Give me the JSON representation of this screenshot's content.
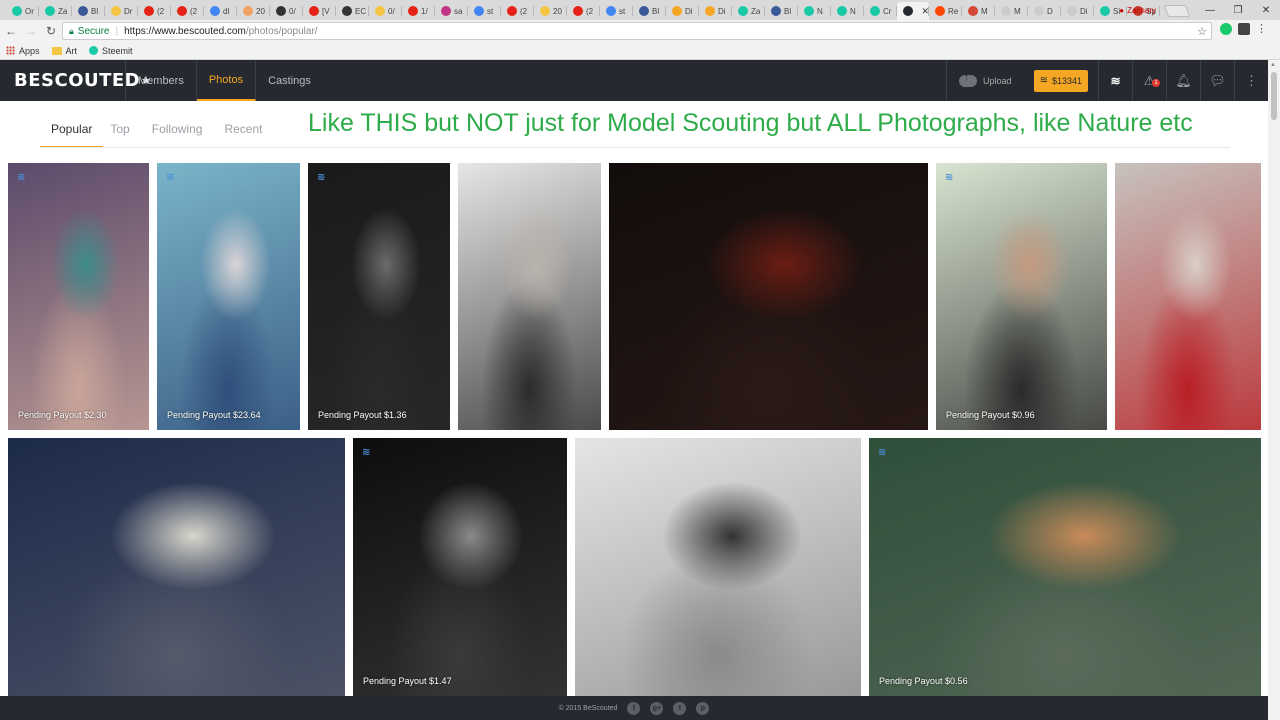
{
  "browser": {
    "tabs": [
      {
        "label": "Or",
        "color": "#1ac9a6"
      },
      {
        "label": "Za",
        "color": "#1ac9a6"
      },
      {
        "label": "Bl",
        "color": "#3b5998"
      },
      {
        "label": "Dr",
        "color": "#f4c542"
      },
      {
        "label": "(2",
        "color": "#e62117"
      },
      {
        "label": "(2",
        "color": "#e62117"
      },
      {
        "label": "dl",
        "color": "#4285f4"
      },
      {
        "label": "20",
        "color": "#f4a261"
      },
      {
        "label": "0/",
        "color": "#333333"
      },
      {
        "label": "[V",
        "color": "#e62117"
      },
      {
        "label": "EC",
        "color": "#333333"
      },
      {
        "label": "0/",
        "color": "#f4c542"
      },
      {
        "label": "1/",
        "color": "#e62117"
      },
      {
        "label": "sa",
        "color": "#c13584"
      },
      {
        "label": "st",
        "color": "#4285f4"
      },
      {
        "label": "(2",
        "color": "#e62117"
      },
      {
        "label": "20",
        "color": "#f4c542"
      },
      {
        "label": "(2",
        "color": "#e62117"
      },
      {
        "label": "st",
        "color": "#4285f4"
      },
      {
        "label": "Bl",
        "color": "#3b5998"
      },
      {
        "label": "Di",
        "color": "#f5a623"
      },
      {
        "label": "Di",
        "color": "#f5a623"
      },
      {
        "label": "Za",
        "color": "#1ac9a6"
      },
      {
        "label": "Bl",
        "color": "#3b5998"
      },
      {
        "label": "N",
        "color": "#1ac9a6"
      },
      {
        "label": "N",
        "color": "#1ac9a6"
      },
      {
        "label": "Cr",
        "color": "#1ac9a6"
      },
      {
        "label": "",
        "color": "#262a30",
        "active": true
      },
      {
        "label": "Re",
        "color": "#ff4500"
      },
      {
        "label": "M",
        "color": "#d44638"
      },
      {
        "label": "M",
        "color": "#cccccc"
      },
      {
        "label": "D",
        "color": "#cccccc"
      },
      {
        "label": "Di",
        "color": "#cccccc"
      },
      {
        "label": "Si",
        "color": "#1ac9a6"
      },
      {
        "label": "Sp",
        "color": "#c0392b"
      }
    ],
    "user": "Zachary",
    "secure_label": "Secure",
    "url_host": "https://www.bescouted.com",
    "url_path": "/photos/popular/",
    "bookmarks": [
      "Apps",
      "Art",
      "Steemit"
    ]
  },
  "header": {
    "logo": "BESCOUTED",
    "nav": [
      "Members",
      "Photos",
      "Castings"
    ],
    "active_nav": "Photos",
    "upload_label": "Upload",
    "balance": "$13341",
    "notification_badge": "1"
  },
  "subtabs": [
    "Popular",
    "Top",
    "Following",
    "Recent"
  ],
  "active_subtab": "Popular",
  "annotation": "Like THIS but NOT just for Model Scouting but ALL Photographs, like Nature etc",
  "photos": [
    {
      "payout": "Pending Payout $2.30",
      "steem": true,
      "colors": [
        "#5b4a6b",
        "#3d8c8a",
        "#c9a59a"
      ]
    },
    {
      "payout": "Pending Payout $23.64",
      "steem": true,
      "colors": [
        "#7bb4c9",
        "#d9d4d6",
        "#2f4f7a"
      ]
    },
    {
      "payout": "Pending Payout $1.36",
      "steem": true,
      "colors": [
        "#1a1a1a",
        "#6b6b6b",
        "#2a2a2a"
      ]
    },
    {
      "payout": "",
      "steem": false,
      "colors": [
        "#e8e6e4",
        "#b9b3ad",
        "#2b2b2b"
      ]
    },
    {
      "payout": "",
      "steem": false,
      "colors": [
        "#120d0c",
        "#6b1d14",
        "#2b1a17"
      ]
    },
    {
      "payout": "Pending Payout $0.96",
      "steem": true,
      "colors": [
        "#d8e4d0",
        "#c59a80",
        "#2a2a2a"
      ]
    },
    {
      "payout": "",
      "steem": false,
      "colors": [
        "#c7c2bd",
        "#d8cfc6",
        "#b91f25"
      ]
    },
    {
      "payout": "",
      "steem": false,
      "colors": [
        "#1c2a4a",
        "#d8d6cc",
        "#555a6b"
      ]
    },
    {
      "payout": "Pending Payout $1.47",
      "steem": true,
      "colors": [
        "#0d0d0d",
        "#8a8a8a",
        "#3a3a3a"
      ]
    },
    {
      "payout": "",
      "steem": false,
      "colors": [
        "#e5e5e5",
        "#333333",
        "#8a8a8a"
      ]
    },
    {
      "payout": "Pending Payout $0.56",
      "steem": true,
      "colors": [
        "#2f4f3a",
        "#c98b5a",
        "#5a6b5a"
      ]
    }
  ],
  "footer": {
    "copyright": "© 2015 BeScouted",
    "social": [
      "f",
      "g+",
      "t",
      "p"
    ]
  }
}
